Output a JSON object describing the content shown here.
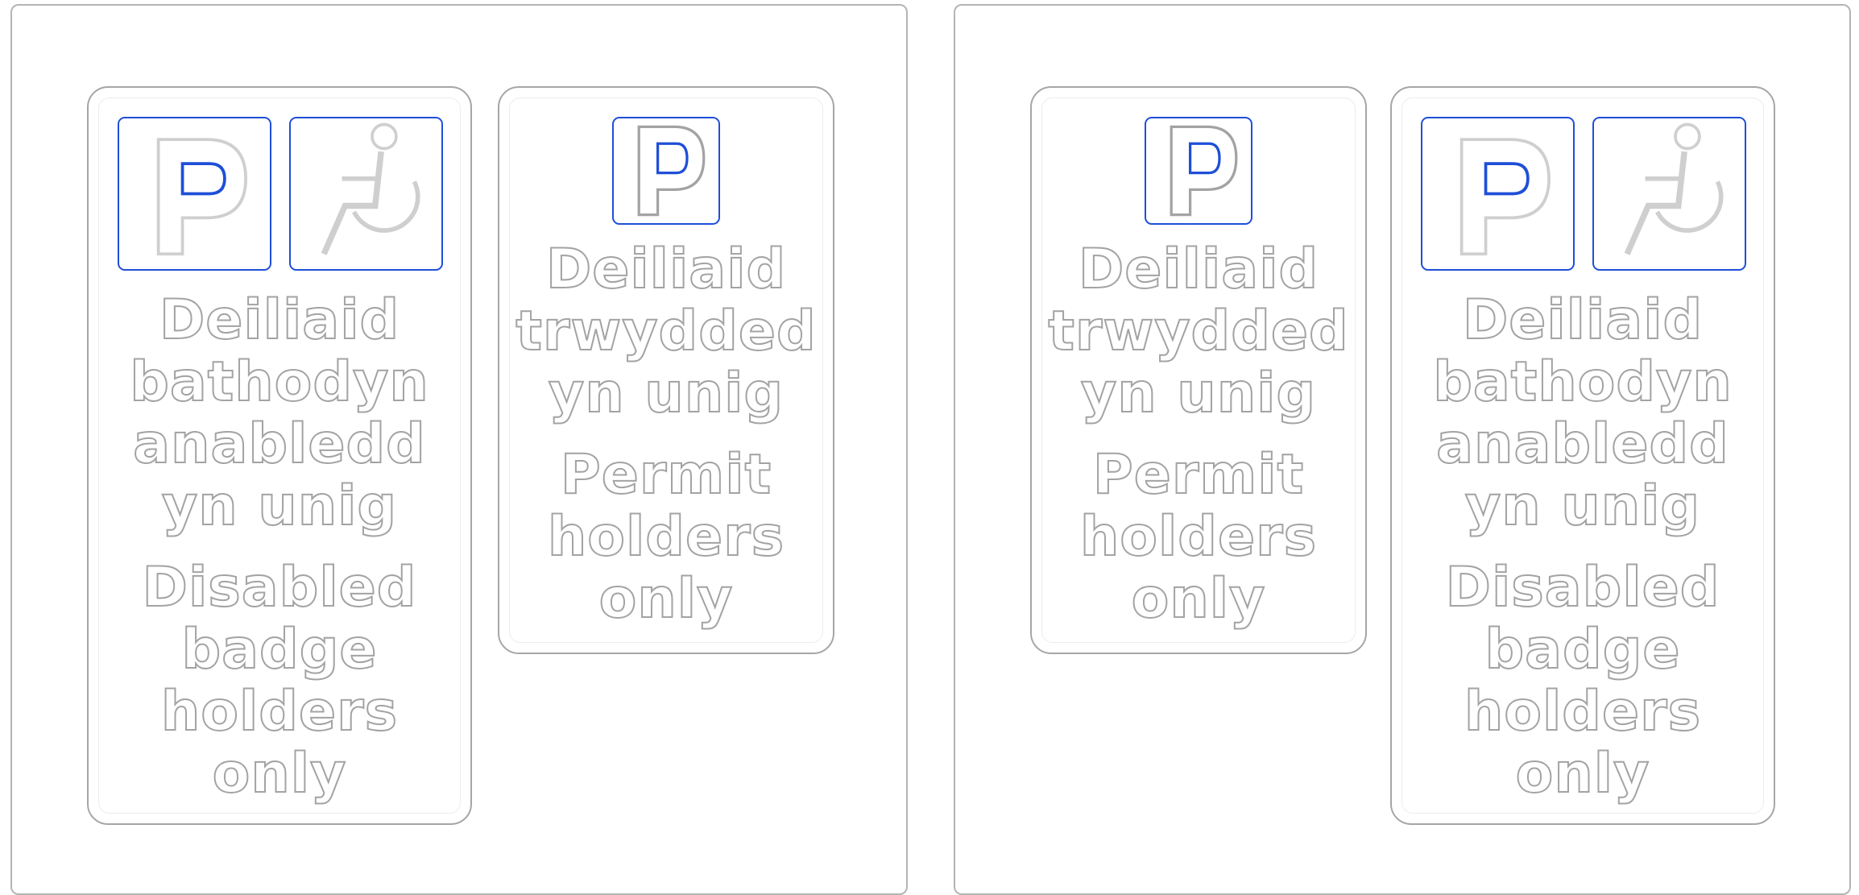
{
  "colors": {
    "frame": "#b4b4b4",
    "sign_border": "#a6a6a6",
    "symbol_border": "#1f4fd8",
    "letter_outline": "#a3a3a3"
  },
  "icons": {
    "parking": "parking-p-icon",
    "disabled": "wheelchair-icon"
  },
  "signs": {
    "disabled": {
      "welsh": [
        "Deiliaid",
        "bathodyn",
        "anabledd",
        "yn unig"
      ],
      "english": [
        "Disabled",
        "badge",
        "holders",
        "only"
      ]
    },
    "permit": {
      "welsh": [
        "Deiliaid",
        "trwydded",
        "yn unig"
      ],
      "english": [
        "Permit",
        "holders",
        "only"
      ]
    }
  }
}
